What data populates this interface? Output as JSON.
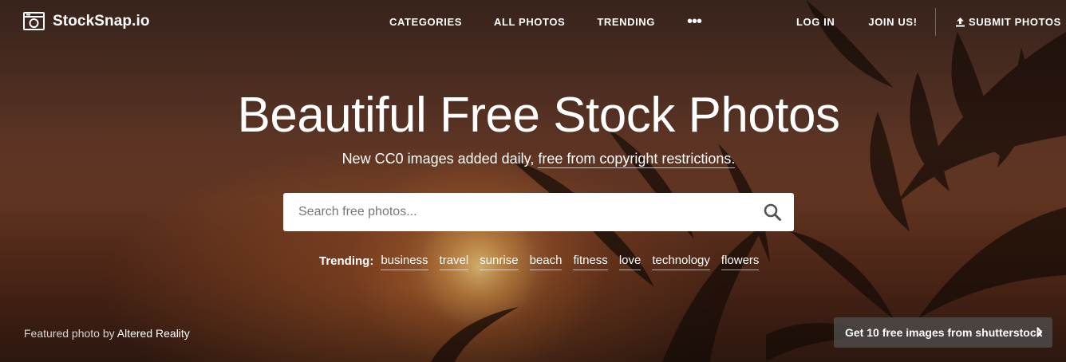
{
  "header": {
    "logo_text": "StockSnap.io",
    "nav": [
      "CATEGORIES",
      "ALL PHOTOS",
      "TRENDING"
    ],
    "more": "•••",
    "login": "LOG IN",
    "join": "JOIN US!",
    "submit": "SUBMIT PHOTOS"
  },
  "hero": {
    "title": "Beautiful Free Stock Photos",
    "subtitle_prefix": "New CC0 images added daily, ",
    "subtitle_link": "free from copyright restrictions."
  },
  "search": {
    "placeholder": "Search free photos..."
  },
  "trending": {
    "label": "Trending:",
    "tags": [
      "business",
      "travel",
      "sunrise",
      "beach",
      "fitness",
      "love",
      "technology",
      "flowers"
    ]
  },
  "footer": {
    "credit_prefix": "Featured photo by ",
    "credit_author": "Altered Reality",
    "shutterstock_cta": "Get 10 free images from shutterstock"
  },
  "icons": {
    "logo": "camera-icon",
    "submit": "upload-icon",
    "search": "search-icon",
    "cta": "chevron-right-icon"
  },
  "colors": {
    "text": "#ffffff",
    "search_bg": "#ffffff",
    "search_icon": "#555555",
    "cta_bg": "#505050"
  }
}
